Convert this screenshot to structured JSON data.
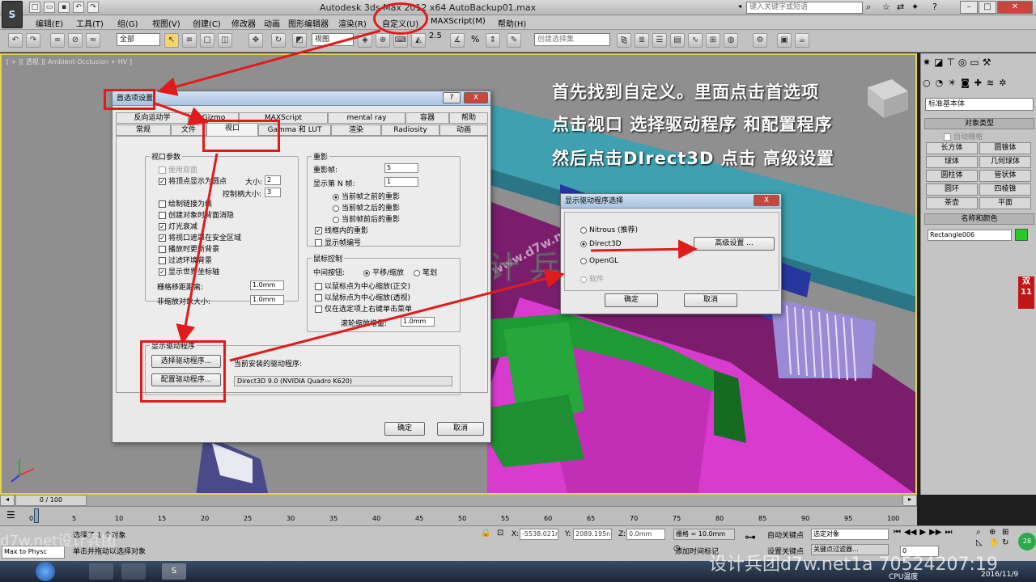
{
  "app": {
    "title": "Autodesk 3ds Max  2012 x64      AutoBackup01.max",
    "logo": "S",
    "search_placeholder": "键入关键字或短语"
  },
  "menu": [
    "编辑(E)",
    "工具(T)",
    "组(G)",
    "视图(V)",
    "创建(C)",
    "修改器",
    "动画",
    "图形编辑器",
    "渲染(R)",
    "自定义(U)",
    "MAXScript(M)",
    "帮助(H)"
  ],
  "toolbar": {
    "filter_value": "全部",
    "view_value": "视图",
    "selection_set_value": "创建选择集",
    "snap_label": "2.5",
    "angle_label": "%"
  },
  "viewport": {
    "label": "[ + ][ 透视 ][ Ambient Occlusion + HV ]",
    "watermark": "www.d7w.net",
    "watermark_cn": "设 计 兵 团"
  },
  "annotation": {
    "line1": "首先找到自定义。里面点击首选项",
    "line2": "点击视口  选择驱动程序 和配置程序",
    "line3": "然后点击DIrect3D 点击 高级设置"
  },
  "prefs_dialog": {
    "title": "首选项设置",
    "help_btn": "?",
    "close_btn": "X",
    "tabs_row1": [
      "反向运动学",
      "Gizmo",
      "MAXScript",
      "mental ray",
      "容器",
      "帮助"
    ],
    "tabs_row2": [
      "常规",
      "文件",
      "视口",
      "Gamma 和 LUT",
      "渲染",
      "Radiosity",
      "动画"
    ],
    "viewport_params": {
      "label": "视口参数",
      "items": [
        {
          "label": "使用双面",
          "checked": false,
          "disabled": true
        },
        {
          "label": "将顶点显示为圆点",
          "checked": true
        },
        {
          "label": "绘制链接为线",
          "checked": false
        },
        {
          "label": "创建对象时背面消隐",
          "checked": false
        },
        {
          "label": "灯光衰减",
          "checked": true
        },
        {
          "label": "将视口遮罩在安全区域",
          "checked": true
        },
        {
          "label": "播放时更新背景",
          "checked": false
        },
        {
          "label": "过滤环境背景",
          "checked": false
        },
        {
          "label": "显示世界坐标轴",
          "checked": true
        }
      ],
      "size_label": "大小:",
      "size_value": "2",
      "handle_label": "控制柄大小:",
      "handle_value": "3",
      "grid_nudge_label": "栅格移距距离:",
      "grid_nudge_value": "1.0mm",
      "nonscale_label": "非缩放对象大小:",
      "nonscale_value": "1.0mm"
    },
    "ghosting": {
      "label": "重影",
      "frames_label": "重影帧:",
      "frames_value": "5",
      "nth_label": "显示第 N 帧:",
      "nth_value": "1",
      "options": [
        "当前帧之前的重影",
        "当前帧之后的重影",
        "当前帧前后的重影"
      ],
      "selected": 0,
      "wire_label": "线框内的重影",
      "wire_checked": true,
      "frame_num_label": "显示帧编号",
      "frame_num_checked": false
    },
    "mouse": {
      "label": "鼠标控制",
      "middle_label": "中间按钮:",
      "pan_zoom": "平移/缩放",
      "stroke": "笔划",
      "items": [
        "以鼠标点为中心缩放(正交)",
        "以鼠标点为中心缩放(透视)",
        "仅在选定项上右键单击菜单"
      ],
      "wheel_label": "滚轮缩放增量:",
      "wheel_value": "1.0mm"
    },
    "driver": {
      "label": "显示驱动程序",
      "choose_btn": "选择驱动程序...",
      "config_btn": "配置驱动程序...",
      "current_label": "当前安装的驱动程序:",
      "current_value": "Direct3D 9.0 (NVIDIA Quadro K620)"
    },
    "ok": "确定",
    "cancel": "取消"
  },
  "driver_dialog": {
    "title": "显示驱动程序选择",
    "close_btn": "X",
    "options": [
      "Nitrous (推荐)",
      "Direct3D",
      "OpenGL",
      "软件"
    ],
    "selected": 1,
    "advanced_btn": "高级设置 ...",
    "ok": "确定",
    "cancel": "取消"
  },
  "command_panel": {
    "category": "标准基本体",
    "object_type_label": "对象类型",
    "autogrid_label": "自动栅格",
    "buttons": [
      "长方体",
      "圆锥体",
      "球体",
      "几何球体",
      "圆柱体",
      "管状体",
      "圆环",
      "四棱锥",
      "茶壶",
      "平面"
    ],
    "name_color_label": "名称和颜色",
    "object_name": "Rectangle006",
    "object_color": "#22cc22"
  },
  "timeline": {
    "frame_label": "0 / 100",
    "ticks": [
      "0",
      "5",
      "10",
      "15",
      "20",
      "25",
      "30",
      "35",
      "40",
      "45",
      "50",
      "55",
      "60",
      "65",
      "70",
      "75",
      "80",
      "85",
      "90",
      "95",
      "100"
    ]
  },
  "status": {
    "selected_text": "选择了 1 个对象",
    "prompt_text": "单击并拖动以选择对象",
    "maxscript_label": "Max to Physc",
    "x_label": "X:",
    "x_value": "-5538.021r",
    "y_label": "Y:",
    "y_value": "2089.195n",
    "z_label": "Z:",
    "z_value": "0.0mm",
    "grid_label": "栅格 = 10.0mm",
    "add_time_tag": "添加时间标记",
    "autokey": "自动关键点",
    "set_key": "设置关键点",
    "selected_object": "选定对象",
    "key_filters": "关键点过滤器...",
    "frame_spinner": "0"
  },
  "taskbar": {
    "cpu_label": "CPU温度",
    "date": "2016/11/9",
    "watermark": "设计兵团d7w.net1a 70524207:19",
    "bottom_left_watermark": "d7w.net设计兵团"
  }
}
